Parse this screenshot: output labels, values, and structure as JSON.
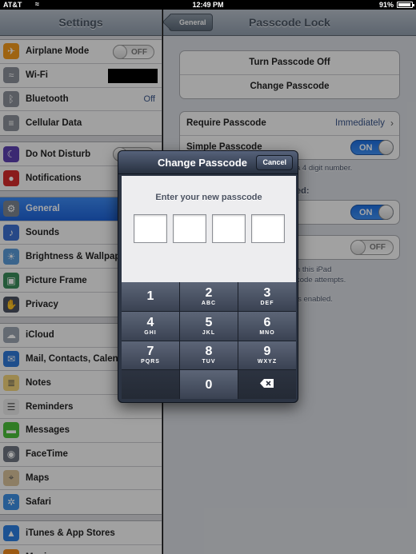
{
  "status_bar": {
    "carrier": "AT&T",
    "time": "12:49 PM",
    "battery": "91%"
  },
  "settings": {
    "title": "Settings",
    "groups": [
      [
        {
          "label": "Airplane Mode",
          "icon": "airplane-icon",
          "toggle": "OFF"
        },
        {
          "label": "Wi-Fi",
          "icon": "wifi-icon",
          "value": ""
        },
        {
          "label": "Bluetooth",
          "icon": "bluetooth-icon",
          "value": "Off"
        },
        {
          "label": "Cellular Data",
          "icon": "cellular-icon"
        }
      ],
      [
        {
          "label": "Do Not Disturb",
          "icon": "moon-icon",
          "toggle": "OFF"
        },
        {
          "label": "Notifications",
          "icon": "notifications-icon"
        }
      ],
      [
        {
          "label": "General",
          "icon": "gear-icon",
          "selected": true
        },
        {
          "label": "Sounds",
          "icon": "speaker-icon"
        },
        {
          "label": "Brightness & Wallpaper",
          "icon": "brightness-icon"
        },
        {
          "label": "Picture Frame",
          "icon": "picture-frame-icon"
        },
        {
          "label": "Privacy",
          "icon": "hand-icon"
        }
      ],
      [
        {
          "label": "iCloud",
          "icon": "cloud-icon"
        },
        {
          "label": "Mail, Contacts, Calendars",
          "icon": "mail-icon"
        },
        {
          "label": "Notes",
          "icon": "notes-icon"
        },
        {
          "label": "Reminders",
          "icon": "reminders-icon"
        },
        {
          "label": "Messages",
          "icon": "messages-icon"
        },
        {
          "label": "FaceTime",
          "icon": "facetime-icon"
        },
        {
          "label": "Maps",
          "icon": "maps-icon"
        },
        {
          "label": "Safari",
          "icon": "safari-icon"
        }
      ],
      [
        {
          "label": "iTunes & App Stores",
          "icon": "app-store-icon"
        },
        {
          "label": "Music",
          "icon": "music-icon"
        }
      ]
    ]
  },
  "detail": {
    "back_label": "General",
    "title": "Passcode Lock",
    "turn_off": "Turn Passcode Off",
    "change": "Change Passcode",
    "require_label": "Require Passcode",
    "require_value": "Immediately",
    "simple_label": "Simple Passcode",
    "simple_toggle": "ON",
    "simple_footnote": "a 4 digit number.",
    "allow_header": "ed:",
    "allow_toggle": "ON",
    "erase_toggle": "OFF",
    "erase_footnote_1": "n this iPad",
    "erase_footnote_2": "code attempts.",
    "erase_footnote_3": "is enabled."
  },
  "modal": {
    "title": "Change Passcode",
    "cancel": "Cancel",
    "prompt": "Enter your new passcode",
    "keys": [
      {
        "num": "1",
        "letters": ""
      },
      {
        "num": "2",
        "letters": "ABC"
      },
      {
        "num": "3",
        "letters": "DEF"
      },
      {
        "num": "4",
        "letters": "GHI"
      },
      {
        "num": "5",
        "letters": "JKL"
      },
      {
        "num": "6",
        "letters": "MNO"
      },
      {
        "num": "7",
        "letters": "PQRS"
      },
      {
        "num": "8",
        "letters": "TUV"
      },
      {
        "num": "9",
        "letters": "WXYZ"
      },
      {
        "num": "",
        "letters": ""
      },
      {
        "num": "0",
        "letters": ""
      },
      {
        "num": "",
        "letters": "",
        "icon": "delete-icon"
      }
    ]
  }
}
